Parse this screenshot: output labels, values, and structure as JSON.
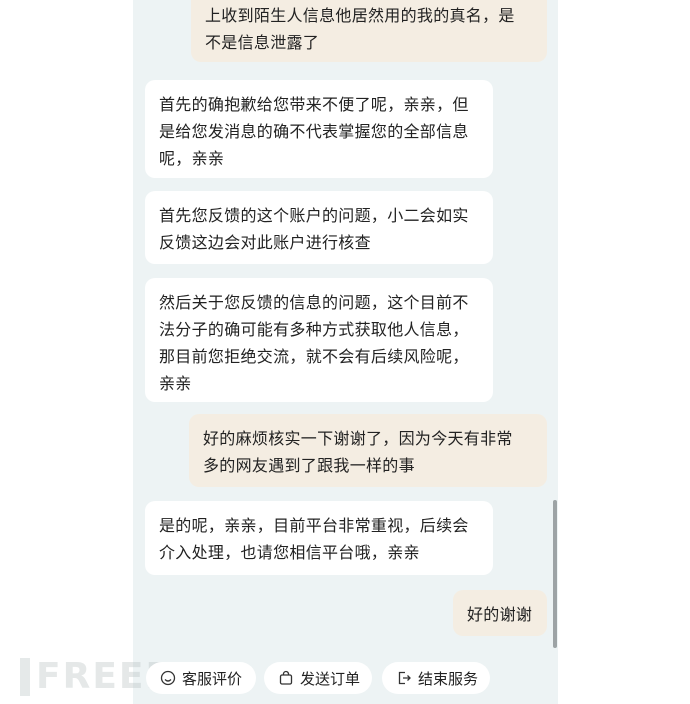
{
  "messages": [
    {
      "role": "user",
      "text": "上收到陌生人信息他居然用的我的真名，是\n不是信息泄露了"
    },
    {
      "role": "agent",
      "text": "首先的确抱歉给您带来不便了呢，亲亲，但\n是给您发消息的确不代表掌握您的全部信息\n呢，亲亲"
    },
    {
      "role": "agent",
      "text": "首先您反馈的这个账户的问题，小二会如实\n反馈这边会对此账户进行核查"
    },
    {
      "role": "agent",
      "text": "然后关于您反馈的信息的问题，这个目前不\n法分子的确可能有多种方式获取他人信息，\n那目前您拒绝交流，就不会有后续风险呢，\n亲亲"
    },
    {
      "role": "user",
      "text": "好的麻烦核实一下谢谢了，因为今天有非常\n多的网友遇到了跟我一样的事"
    },
    {
      "role": "agent",
      "text": "是的呢，亲亲，目前平台非常重视，后续会\n介入处理，也请您相信平台哦，亲亲"
    },
    {
      "role": "user",
      "text": "好的谢谢"
    }
  ],
  "actions": [
    {
      "label": "客服评价",
      "icon": "smiley-icon"
    },
    {
      "label": "发送订单",
      "icon": "bag-icon"
    },
    {
      "label": "结束服务",
      "icon": "exit-icon"
    }
  ],
  "watermark": "FREEBUF"
}
